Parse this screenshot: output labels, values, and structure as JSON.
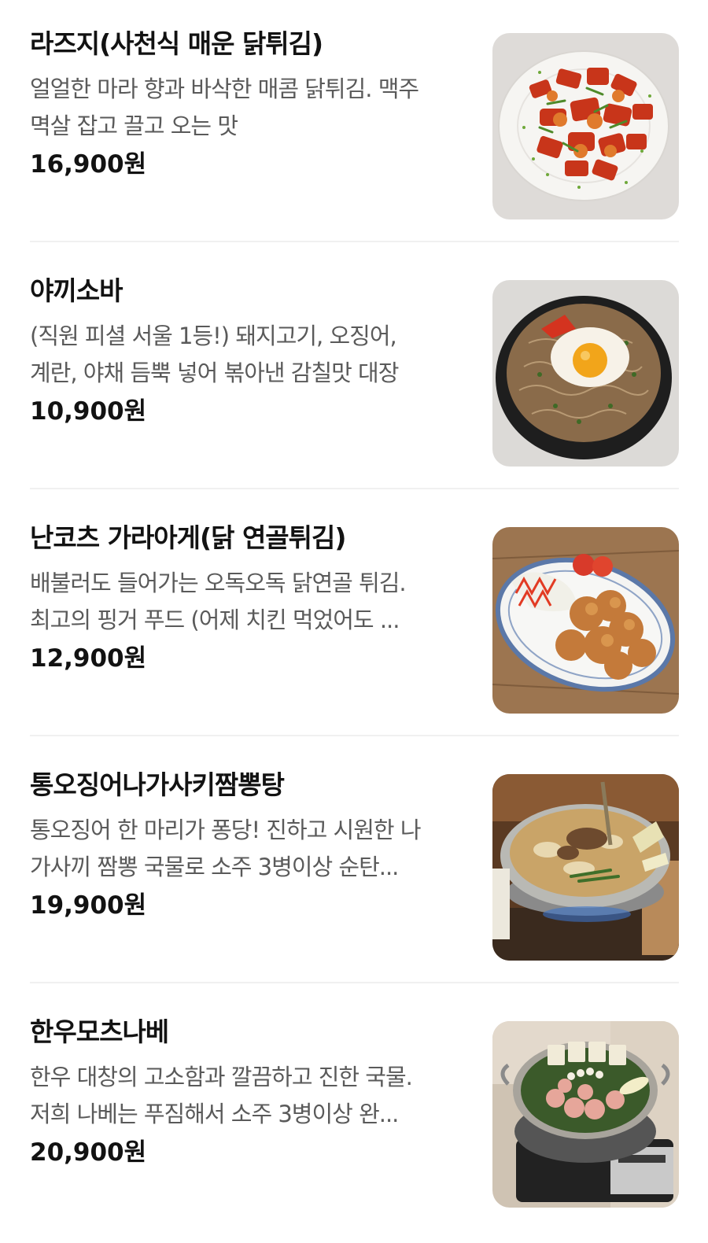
{
  "menu": {
    "items": [
      {
        "name": "라즈지(사천식 매운 닭튀김)",
        "desc_line1": "얼얼한 마라 향과 바삭한 매콤 닭튀김. 맥주",
        "desc_line2": "멱살 잡고 끌고 오는 맛",
        "price": "16,900원",
        "photo_icon": "spicy-chicken-photo"
      },
      {
        "name": "야끼소바",
        "desc_line1": "(직원 피셜 서울 1등!) 돼지고기, 오징어,",
        "desc_line2": "계란, 야채 듬뿍 넣어 볶아낸 감칠맛 대장",
        "price": "10,900원",
        "photo_icon": "yakisoba-photo"
      },
      {
        "name": "난코츠 가라아게(닭 연골튀김)",
        "desc_line1": "배불러도 들어가는 오독오독 닭연골 튀김.",
        "desc_line2": "최고의 핑거 푸드 (어제 치킨 먹었어도 ...",
        "price": "12,900원",
        "photo_icon": "karaage-photo"
      },
      {
        "name": "통오징어나가사키짬뽕탕",
        "desc_line1": "통오징어 한 마리가 퐁당! 진하고 시원한 나",
        "desc_line2": "가사끼 짬뽕 국물로 소주 3병이상 순탄...",
        "price": "19,900원",
        "photo_icon": "jjamppong-pot-photo"
      },
      {
        "name": "한우모츠나베",
        "desc_line1": "한우 대창의 고소함과 깔끔하고 진한 국물.",
        "desc_line2": "저희 나베는 푸짐해서 소주 3병이상 완...",
        "price": "20,900원",
        "photo_icon": "motsunabe-pot-photo"
      }
    ]
  },
  "colors": {
    "text_primary": "#121212",
    "text_secondary": "#5a5a5a",
    "divider": "#f0f0f0",
    "background": "#ffffff"
  }
}
